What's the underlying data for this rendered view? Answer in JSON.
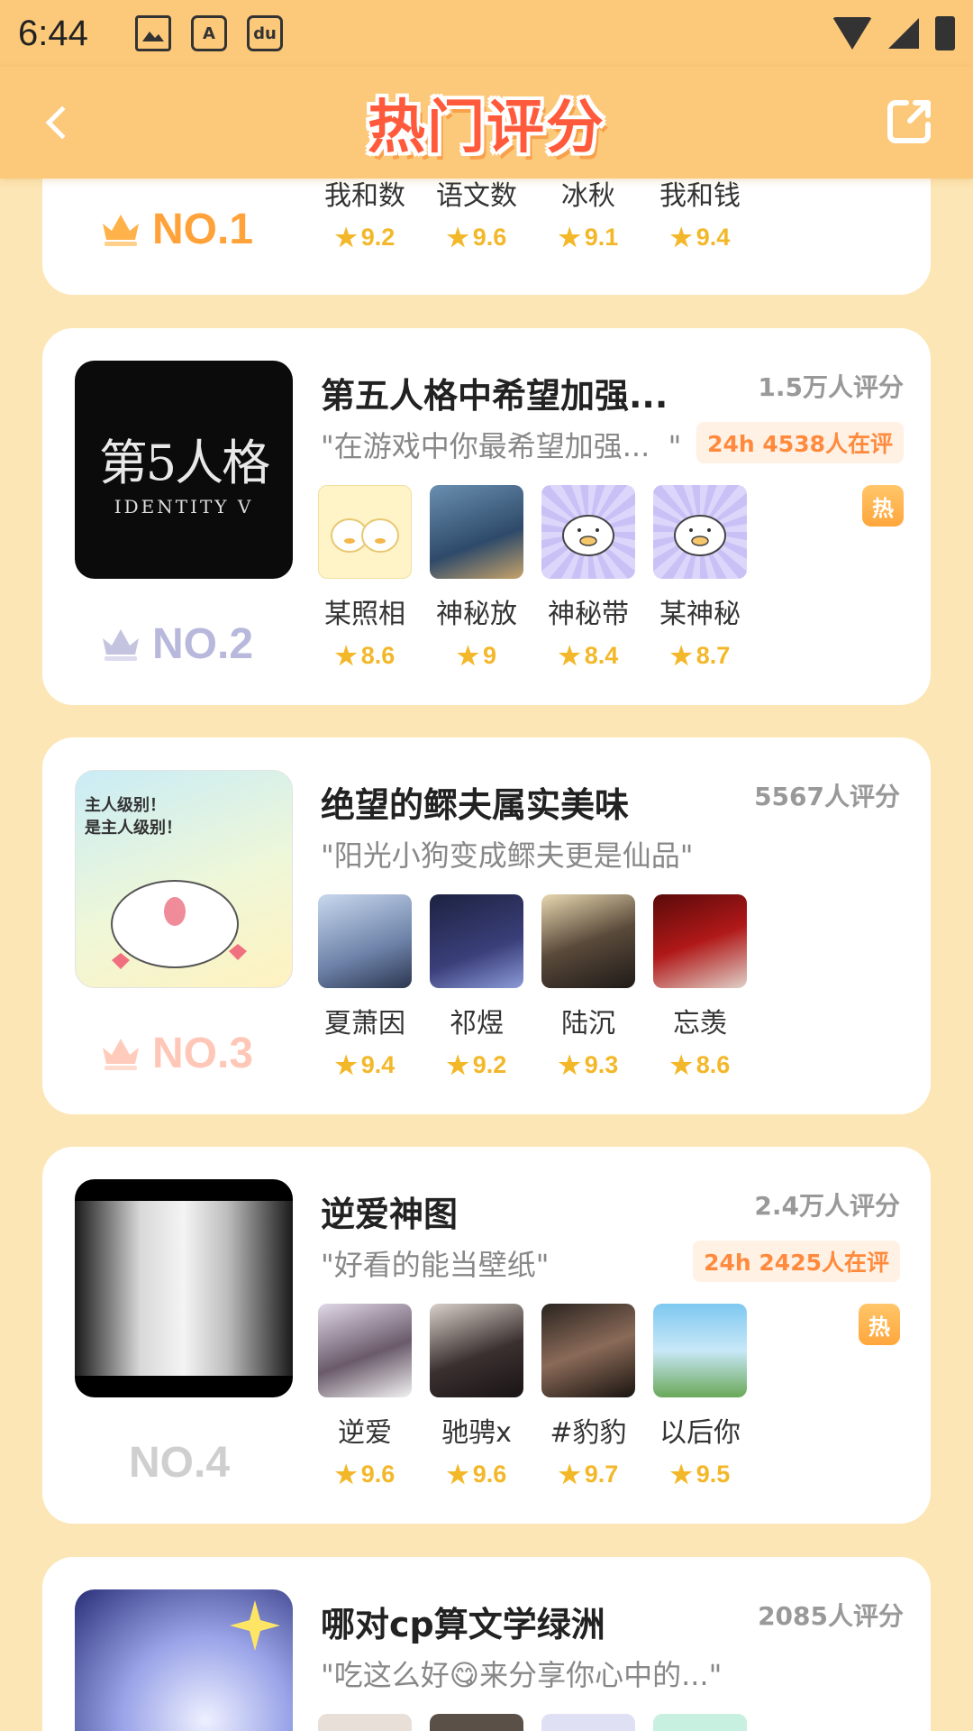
{
  "status_bar": {
    "time": "6:44",
    "icon_text_1": "A",
    "icon_text_2": "du"
  },
  "header": {
    "title": "热门评分"
  },
  "colors": {
    "accent": "#fcc97a",
    "star": "#f3b82a",
    "live_text": "#ff8a3d",
    "title_red": "#ff5a3c"
  },
  "cards": [
    {
      "rank": "NO.1",
      "candidates": [
        {
          "name": "我和数",
          "score": "9.2"
        },
        {
          "name": "语文数",
          "score": "9.6"
        },
        {
          "name": "冰秋",
          "score": "9.1"
        },
        {
          "name": "我和钱",
          "score": "9.4"
        }
      ]
    },
    {
      "rank": "NO.2",
      "title": "第五人格中希望加强...",
      "quote": "\"在游戏中你最希望加强...  \"",
      "rating_count": "1.5万人评分",
      "live": "24h 4538人在评",
      "hot": "热",
      "cover_text": "第5人格",
      "cover_subtext": "IDENTITY V",
      "candidates": [
        {
          "name": "某照相",
          "score": "8.6"
        },
        {
          "name": "神秘放",
          "score": "9"
        },
        {
          "name": "神秘带",
          "score": "8.4"
        },
        {
          "name": "某神秘",
          "score": "8.7"
        }
      ]
    },
    {
      "rank": "NO.3",
      "title": "绝望的鳏夫属实美味",
      "quote": "\"阳光小狗变成鳏夫更是仙品\"",
      "rating_count": "5567人评分",
      "cover_text": "主人级别！\n是主人级别！",
      "candidates": [
        {
          "name": "夏萧因",
          "score": "9.4"
        },
        {
          "name": "祁煜",
          "score": "9.2"
        },
        {
          "name": "陆沉",
          "score": "9.3"
        },
        {
          "name": "忘羡",
          "score": "8.6"
        }
      ]
    },
    {
      "rank": "NO.4",
      "title": "逆爱神图",
      "quote": "\"好看的能当壁纸\"",
      "rating_count": "2.4万人评分",
      "live": "24h 2425人在评",
      "hot": "热",
      "candidates": [
        {
          "name": "逆爱",
          "score": "9.6"
        },
        {
          "name": "驰骋x",
          "score": "9.6"
        },
        {
          "name": "#豹豹",
          "score": "9.7"
        },
        {
          "name": "以后你",
          "score": "9.5"
        }
      ]
    },
    {
      "title": "哪对cp算文学绿洲",
      "quote": "\"吃这么好😋来分享你心中的...\"",
      "rating_count": "2085人评分"
    }
  ]
}
